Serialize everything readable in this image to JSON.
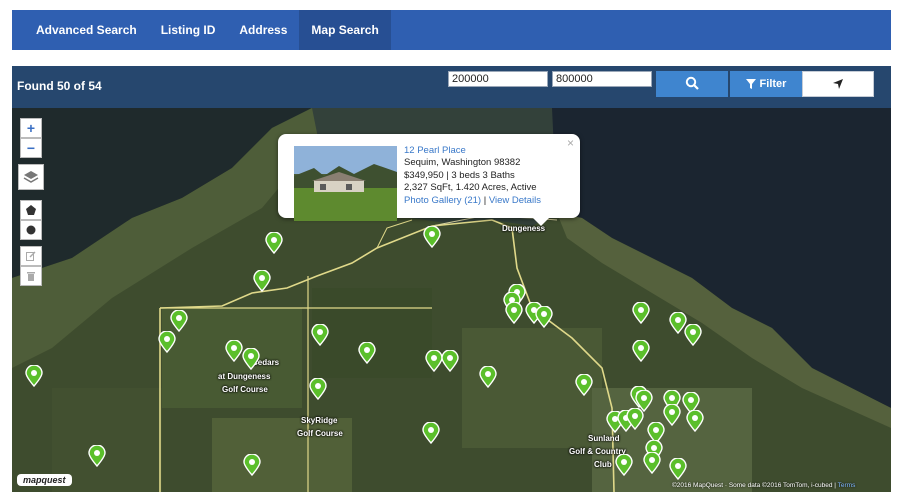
{
  "nav": {
    "tabs": [
      {
        "label": "Advanced Search"
      },
      {
        "label": "Listing ID"
      },
      {
        "label": "Address"
      },
      {
        "label": "Map Search"
      }
    ]
  },
  "toolbar": {
    "found_text": "Found 50 of 54",
    "min_price": "200000",
    "max_price": "800000",
    "filter_label": "Filter"
  },
  "map": {
    "zoom_in": "+",
    "zoom_out": "−",
    "labels": [
      {
        "text": "Dungeness"
      },
      {
        "text": "Cedars"
      },
      {
        "text": "at Dungeness"
      },
      {
        "text": "Golf Course"
      },
      {
        "text": "SkyRidge"
      },
      {
        "text": "Golf Course"
      },
      {
        "text": "Sunland"
      },
      {
        "text": "Golf & Country"
      },
      {
        "text": "Club"
      }
    ],
    "logo": "mapquest",
    "attribution": "©2016 MapQuest · Some data ©2016 TomTom, i-cubed | ",
    "attribution_link": "Terms",
    "marker_color": "#5bbf2b"
  },
  "popup": {
    "address": "12 Pearl Place",
    "city_line": "Sequim, Washington 98382",
    "price_line": "$349,950 | 3 beds 3 Baths",
    "size_line": "2,327 SqFt, 1.420 Acres, Active",
    "gallery_link": "Photo Gallery (21)",
    "separator": " | ",
    "details_link": "View Details",
    "close": "×"
  }
}
